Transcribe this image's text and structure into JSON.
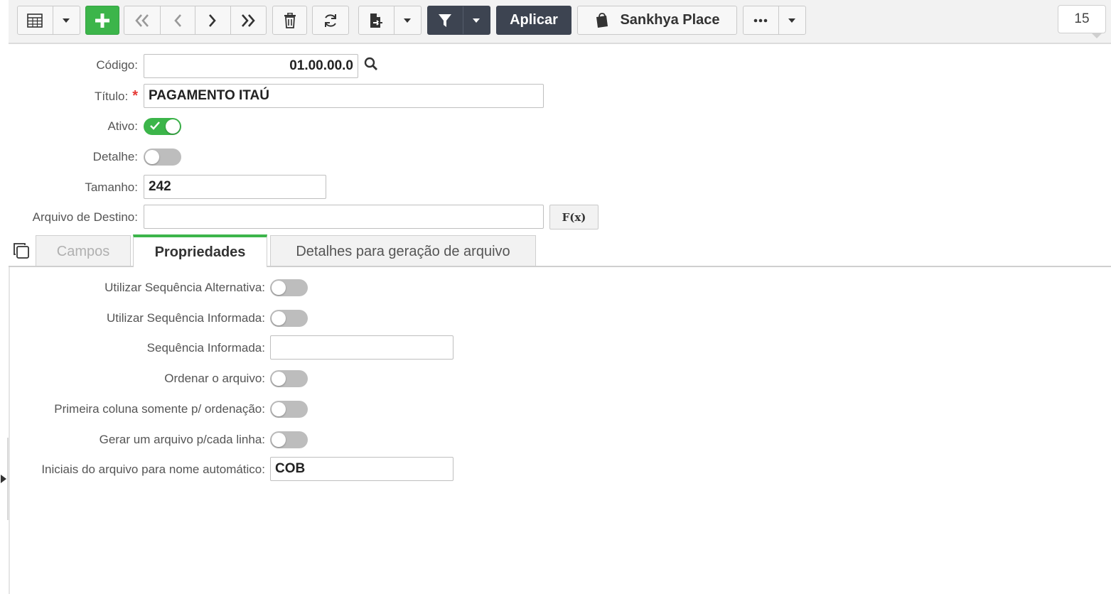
{
  "toolbar": {
    "apply_label": "Aplicar",
    "place_label": "Sankhya Place",
    "page_count": "15",
    "icons": [
      "table-icon",
      "chevron-down-icon",
      "plus-icon",
      "first-icon",
      "prev-icon",
      "next-icon",
      "last-icon",
      "trash-icon",
      "refresh-icon",
      "export-icon",
      "filter-icon",
      "bag-icon",
      "more-icon"
    ]
  },
  "form": {
    "codigo_label": "Código:",
    "codigo_value": "01.00.00.0",
    "titulo_label": "Título:",
    "titulo_required": "*",
    "titulo_value": "PAGAMENTO ITAÚ",
    "ativo_label": "Ativo:",
    "ativo_on": true,
    "detalhe_label": "Detalhe:",
    "detalhe_on": false,
    "tamanho_label": "Tamanho:",
    "tamanho_value": "242",
    "arquivo_label": "Arquivo de Destino:",
    "arquivo_value": "",
    "fx_label": "F(x)"
  },
  "tabs": [
    {
      "label": "Campos",
      "state": "disabled"
    },
    {
      "label": "Propriedades",
      "state": "active"
    },
    {
      "label": "Detalhes para geração de arquivo",
      "state": "normal"
    }
  ],
  "properties": {
    "seq_alternativa_label": "Utilizar Sequência Alternativa:",
    "seq_informada_label": "Utilizar Sequência Informada:",
    "sequencia_label": "Sequência Informada:",
    "sequencia_value": "",
    "ordenar_label": "Ordenar o arquivo:",
    "primeira_coluna_label": "Primeira coluna somente p/ ordenação:",
    "gerar_label": "Gerar um arquivo p/cada linha:",
    "iniciais_label": "Iniciais do arquivo para nome automático:",
    "iniciais_value": "COB"
  }
}
